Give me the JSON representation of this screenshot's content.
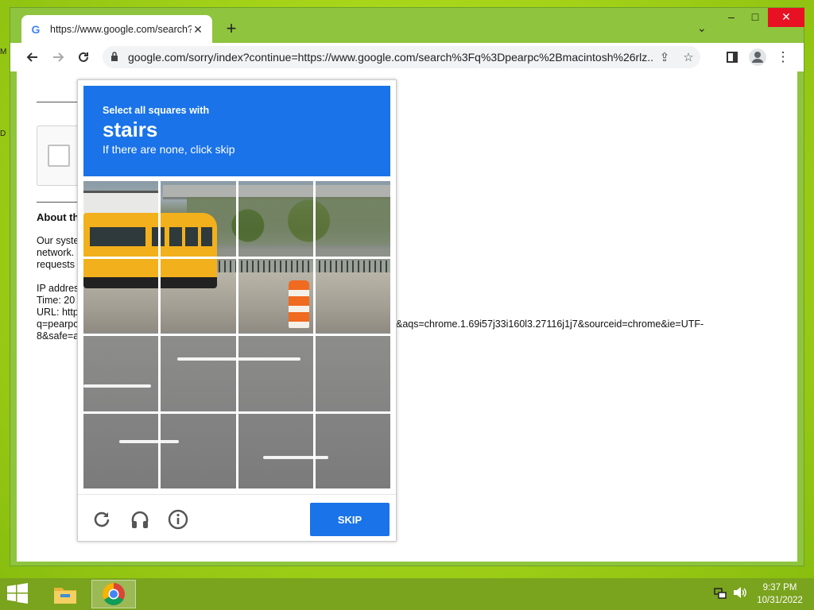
{
  "desktop": {
    "edge_marks": [
      "M",
      "D"
    ]
  },
  "browser": {
    "tab": {
      "title": "https://www.google.com/search?q=",
      "favicon_letter": "G"
    },
    "window_controls": {
      "minimize": "–",
      "maximize": "□",
      "close": "✕"
    },
    "address_bar": {
      "url": "google.com/sorry/index?continue=https://www.google.com/search%3Fq%3Dpearpc%2Bmacintosh%26rlz..."
    }
  },
  "page": {
    "about_heading": "About th",
    "para_lines": [
      "Our syste",
      "network.",
      "requests"
    ],
    "info_lines": [
      "IP addres",
      "Time: 20",
      "URL: http",
      "q=pearpc",
      "8&safe=a"
    ],
    "url_tail_line1": "&aqs=chrome.1.69i57j33i160l3.27116j1j7&sourceid=chrome&ie=UTF-",
    "url_tail_line2": ""
  },
  "captcha": {
    "instruction_small": "Select all squares with",
    "instruction_target": "stairs",
    "instruction_sub": "If there are none, click skip",
    "skip_label": "SKIP",
    "grid_rows": 4,
    "grid_cols": 4
  },
  "taskbar": {
    "clock_time": "9:37 PM",
    "clock_date": "10/31/2022"
  },
  "colors": {
    "captcha_blue": "#1a73e8",
    "desktop_green": "#a8d61a",
    "taskbar_green": "#7aa31e"
  }
}
